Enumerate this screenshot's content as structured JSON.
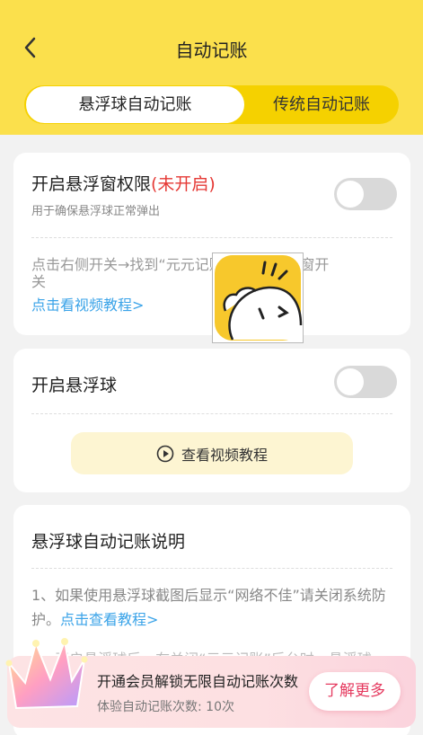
{
  "header": {
    "title": "自动记账",
    "tabs": [
      {
        "label": "悬浮球自动记账",
        "active": true
      },
      {
        "label": "传统自动记账",
        "active": false
      }
    ]
  },
  "permission_card": {
    "title": "开启悬浮窗权限",
    "status": "(未开启)",
    "subtitle": "用于确保悬浮球正常弹出",
    "hint_line1": "点击右侧开关→找到“元元记账”→开启悬浮窗开",
    "hint_line2": "关",
    "tutorial_link": "点击看视频教程>",
    "toggle_on": false
  },
  "float_card": {
    "title": "开启悬浮球",
    "toggle_on": false,
    "video_button": "查看视频教程"
  },
  "explain_card": {
    "title": "悬浮球自动记账说明",
    "para1_text": "1、如果使用悬浮球截图后显示“网络不佳”请关闭系统防护。",
    "para1_link": "点击查看教程>",
    "para2_partial": "2、开启悬浮球后，在关闭“元元记账”后台时，悬浮球"
  },
  "vip": {
    "title": "开通会员解锁无限自动记账次数",
    "subtitle": "体验自动记账次数: 10次",
    "button": "了解更多"
  },
  "colors": {
    "header_yellow": "#fbe04c",
    "segment_yellow": "#f5d100",
    "link_blue": "#3aa3e8",
    "status_red": "#e53935",
    "vip_accent": "#e53a5f"
  },
  "icons": {
    "back": "chevron-left-icon",
    "play": "play-circle-icon",
    "mascot": "mascot-icon",
    "crown": "crown-icon"
  }
}
